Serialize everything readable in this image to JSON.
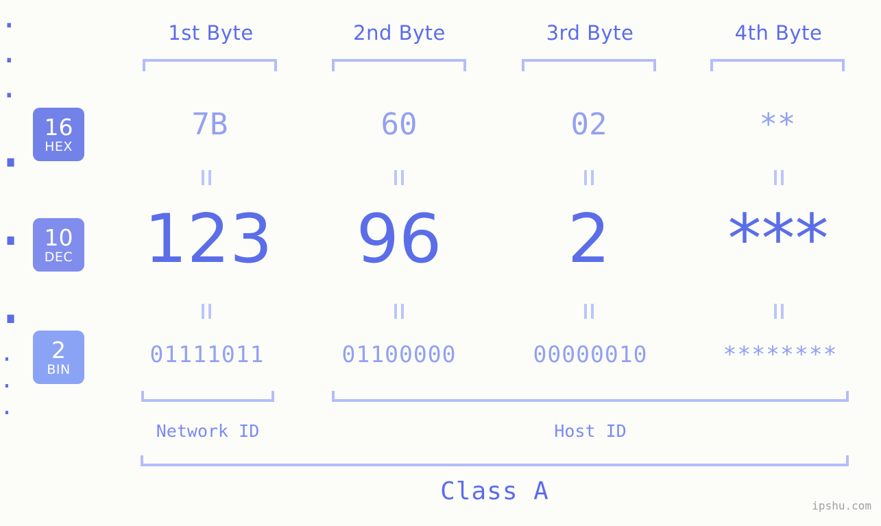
{
  "watermark": "ipshu.com",
  "colors": {
    "background": "#fcfdf9",
    "accent_strong": "#5b6ee8",
    "accent_light": "#93a1f0",
    "bracket": "#b3bdfa",
    "badge_hex": "#7382e8",
    "badge_dec": "#818ded",
    "badge_bin": "#8ba3f5",
    "watermark_gray": "#a0a0a0"
  },
  "byte_headers": [
    {
      "label": "1st Byte"
    },
    {
      "label": "2nd Byte"
    },
    {
      "label": "3rd Byte"
    },
    {
      "label": "4th Byte"
    }
  ],
  "bases": [
    {
      "number": "16",
      "name": "HEX"
    },
    {
      "number": "10",
      "name": "DEC"
    },
    {
      "number": "2",
      "name": "BIN"
    }
  ],
  "separator_dot": ".",
  "equals_mark": "=",
  "rows": {
    "hex": {
      "base_number": "16",
      "base_name": "HEX",
      "values": [
        "7B",
        "60",
        "02",
        "**"
      ]
    },
    "dec": {
      "base_number": "10",
      "base_name": "DEC",
      "values": [
        "123",
        "96",
        "2",
        "***"
      ]
    },
    "bin": {
      "base_number": "2",
      "base_name": "BIN",
      "values": [
        "01111011",
        "01100000",
        "00000010",
        "********"
      ]
    }
  },
  "sections": {
    "network_id": "Network ID",
    "host_id": "Host ID",
    "class": "Class A"
  },
  "chart_data": {
    "type": "table",
    "title": "IP address byte breakdown",
    "columns": [
      "1st Byte",
      "2nd Byte",
      "3rd Byte",
      "4th Byte"
    ],
    "rows": [
      {
        "base": "HEX",
        "radix": 16,
        "cells": [
          "7B",
          "60",
          "02",
          "**"
        ]
      },
      {
        "base": "DEC",
        "radix": 10,
        "cells": [
          "123",
          "96",
          "2",
          "***"
        ]
      },
      {
        "base": "BIN",
        "radix": 2,
        "cells": [
          "01111011",
          "01100000",
          "00000010",
          "********"
        ]
      }
    ],
    "annotations": {
      "network_id_bytes": [
        1
      ],
      "host_id_bytes": [
        2,
        3,
        4
      ],
      "class": "Class A"
    }
  }
}
